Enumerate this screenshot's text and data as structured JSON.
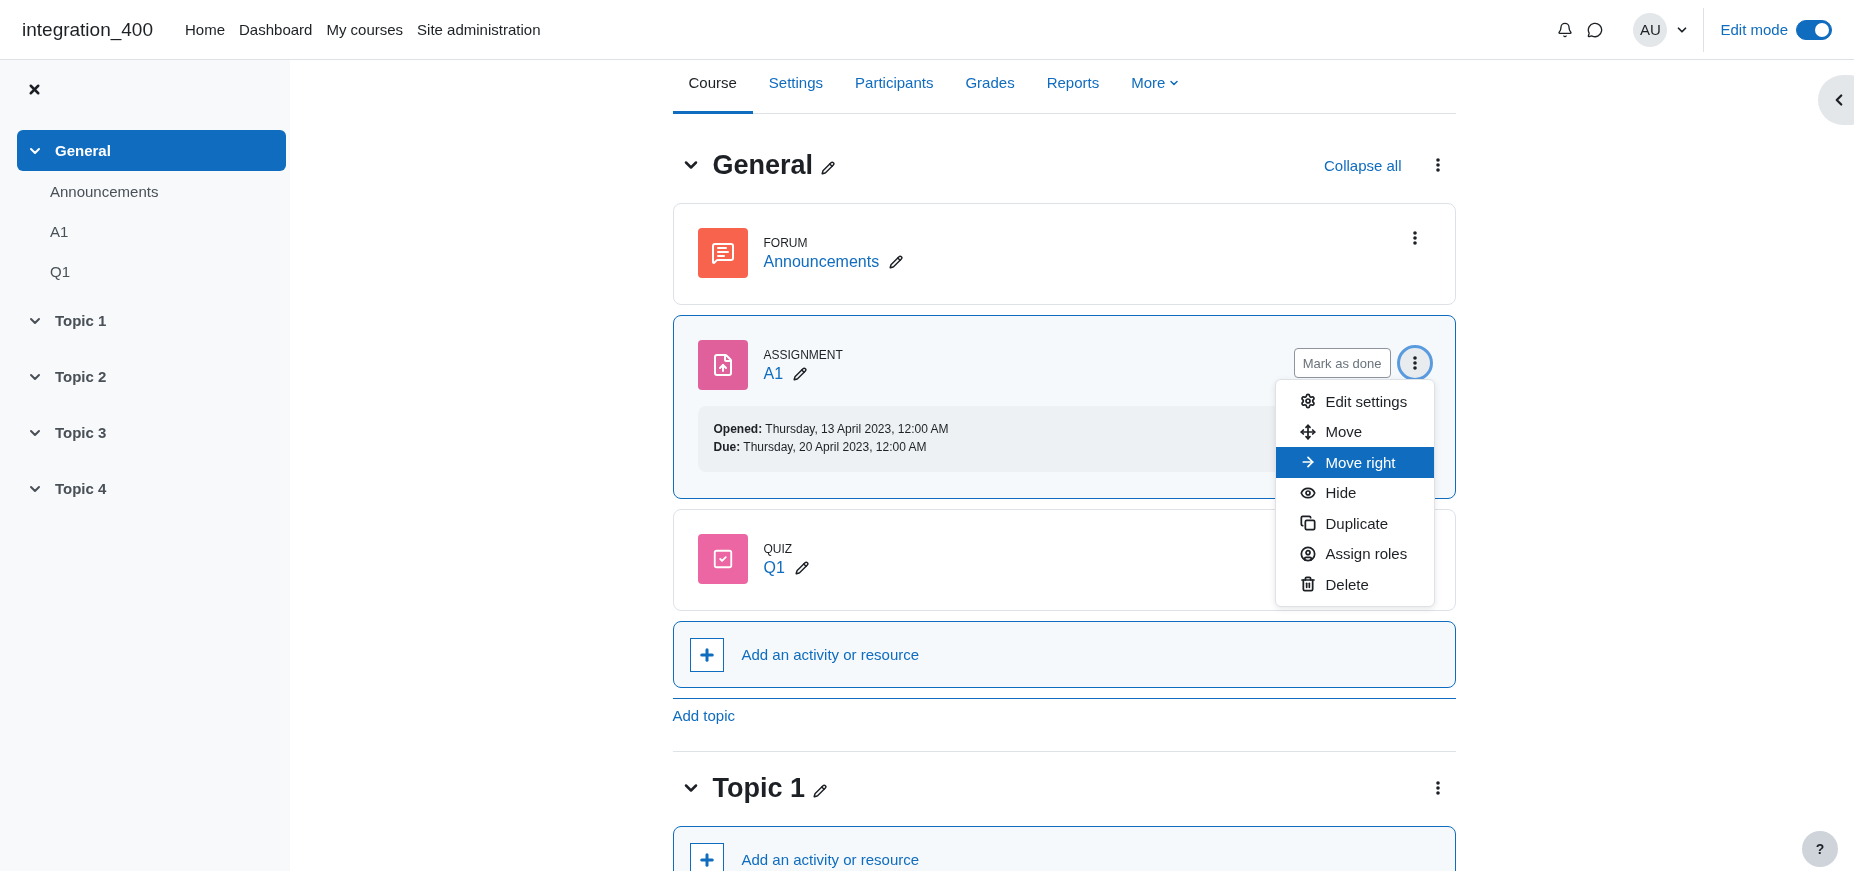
{
  "site_name": "integration_400",
  "nav_links": [
    "Home",
    "Dashboard",
    "My courses",
    "Site administration"
  ],
  "user": {
    "initials": "AU"
  },
  "edit_mode": {
    "label": "Edit mode",
    "on": true
  },
  "course_index": [
    {
      "title": "General",
      "selected": true,
      "expanded": true,
      "children": [
        {
          "label": "Announcements"
        },
        {
          "label": "A1"
        },
        {
          "label": "Q1"
        }
      ]
    },
    {
      "title": "Topic 1",
      "selected": false,
      "expanded": true
    },
    {
      "title": "Topic 2",
      "selected": false,
      "expanded": true
    },
    {
      "title": "Topic 3",
      "selected": false,
      "expanded": true
    },
    {
      "title": "Topic 4",
      "selected": false,
      "expanded": true
    }
  ],
  "tabs": [
    {
      "label": "Course",
      "selected": true,
      "kind": "link"
    },
    {
      "label": "Settings",
      "selected": false,
      "kind": "link"
    },
    {
      "label": "Participants",
      "selected": false,
      "kind": "link"
    },
    {
      "label": "Grades",
      "selected": false,
      "kind": "link"
    },
    {
      "label": "Reports",
      "selected": false,
      "kind": "link"
    },
    {
      "label": "More",
      "selected": false,
      "kind": "menu"
    }
  ],
  "sections": [
    {
      "title": "General",
      "expanded": true,
      "action": "Collapse all",
      "add_label": "Add an activity or resource",
      "add_topic": "Add topic",
      "activities": [
        {
          "kind": "forum",
          "type_label": "FORUM",
          "name": "Announcements",
          "color": "#f7634d",
          "selected": false
        },
        {
          "kind": "assignment",
          "type_label": "ASSIGNMENT",
          "name": "A1",
          "color": "#e0609b",
          "selected": true,
          "completion_button": "Mark as done",
          "dates": [
            {
              "label": "Opened:",
              "value": "Thursday, 13 April 2023, 12:00 AM"
            },
            {
              "label": "Due:",
              "value": "Thursday, 20 April 2023, 12:00 AM"
            }
          ],
          "menu": [
            {
              "kind": "gear",
              "label": "Edit settings",
              "selected": false
            },
            {
              "kind": "move",
              "label": "Move",
              "selected": false
            },
            {
              "kind": "arrow",
              "label": "Move right",
              "selected": true
            },
            {
              "kind": "eye",
              "label": "Hide",
              "selected": false
            },
            {
              "kind": "copy",
              "label": "Duplicate",
              "selected": false
            },
            {
              "kind": "user",
              "label": "Assign roles",
              "selected": false
            },
            {
              "kind": "trash",
              "label": "Delete",
              "selected": false
            }
          ]
        },
        {
          "kind": "quiz",
          "type_label": "QUIZ",
          "name": "Q1",
          "color": "#eb66a2",
          "selected": false
        }
      ]
    },
    {
      "title": "Topic 1",
      "expanded": true,
      "add_label": "Add an activity or resource"
    }
  ],
  "help": {
    "label": "?"
  }
}
